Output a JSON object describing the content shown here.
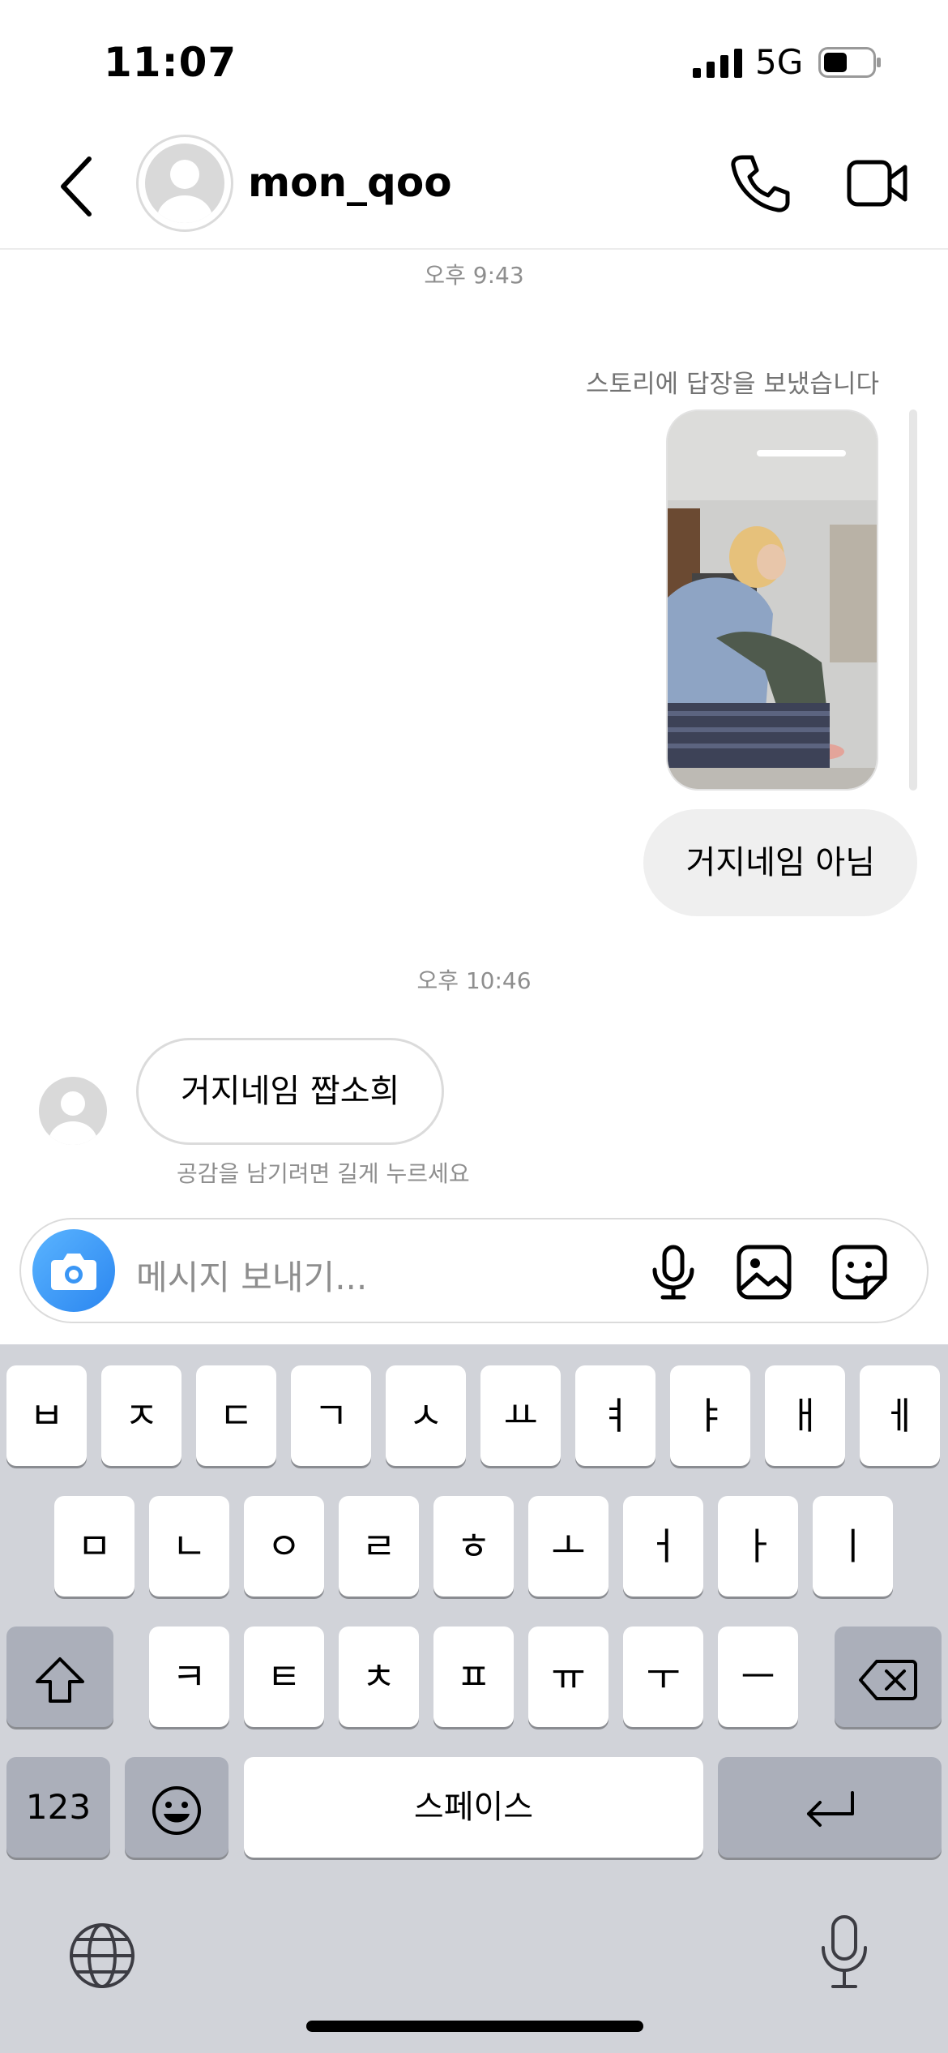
{
  "status_bar": {
    "time": "11:07",
    "network": "5G"
  },
  "header": {
    "username": "mon_qoo",
    "icons": [
      "back-icon",
      "avatar",
      "phone-icon",
      "video-icon"
    ]
  },
  "chat": {
    "timestamp_1": "오후 9:43",
    "story_reply_caption": "스토리에 답장을 보냈습니다",
    "outgoing_message": "거지네임 아님",
    "timestamp_2": "오후 10:46",
    "incoming_message": "거지네임 짭소희",
    "reaction_hint": "공감을 남기려면 길게 누르세요"
  },
  "composer": {
    "placeholder": "메시지 보내기...",
    "icons": [
      "camera-icon",
      "microphone-icon",
      "gallery-icon",
      "sticker-icon"
    ]
  },
  "keyboard": {
    "row1": [
      "ㅂ",
      "ㅈ",
      "ㄷ",
      "ㄱ",
      "ㅅ",
      "ㅛ",
      "ㅕ",
      "ㅑ",
      "ㅐ",
      "ㅔ"
    ],
    "row2": [
      "ㅁ",
      "ㄴ",
      "ㅇ",
      "ㄹ",
      "ㅎ",
      "ㅗ",
      "ㅓ",
      "ㅏ",
      "ㅣ"
    ],
    "row3": [
      "ㅋ",
      "ㅌ",
      "ㅊ",
      "ㅍ",
      "ㅠ",
      "ㅜ",
      "ㅡ"
    ],
    "numbers_label": "123",
    "space_label": "스페이스",
    "icons": [
      "shift-icon",
      "backspace-icon",
      "emoji-icon",
      "return-icon",
      "globe-icon",
      "dictation-icon"
    ]
  },
  "colors": {
    "accent_blue": "#2b86f0",
    "bubble_gray": "#efefef",
    "keyboard_bg": "#d1d3d9",
    "dark_key": "#abafba"
  }
}
